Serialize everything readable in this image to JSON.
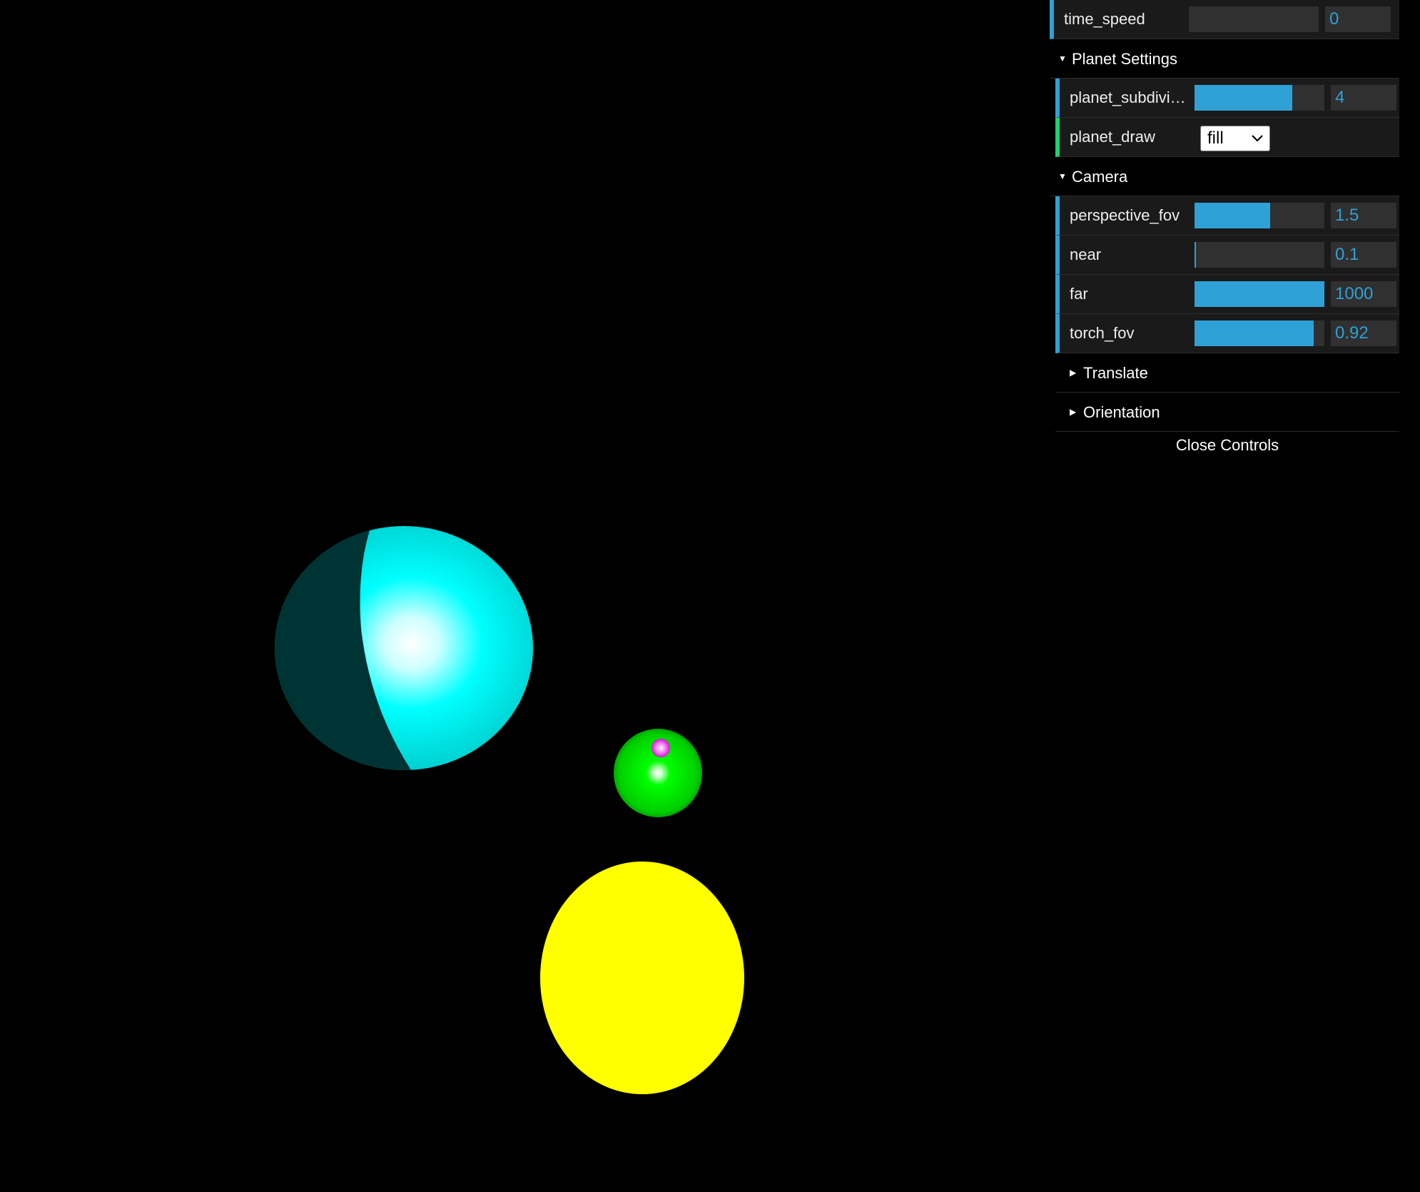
{
  "scene": {
    "background": "#000000",
    "bodies": [
      {
        "name": "cyan-planet",
        "color": "#00ffff"
      },
      {
        "name": "green-planet",
        "color": "#00e600"
      },
      {
        "name": "magenta-moon",
        "color": "#ff33ff"
      },
      {
        "name": "yellow-sun",
        "color": "#ffff00"
      }
    ]
  },
  "gui": {
    "accent_number": "#2fa1d6",
    "accent_option": "#1ed36f",
    "time_speed": {
      "label": "time_speed",
      "value": "0",
      "fill": 0.0
    },
    "planet_settings": {
      "title": "Planet Settings",
      "planet_subdivisions": {
        "label": "planet_subdivisions",
        "value": "4",
        "fill": 0.75
      },
      "planet_draw": {
        "label": "planet_draw",
        "value": "fill",
        "options": [
          "fill"
        ]
      }
    },
    "camera": {
      "title": "Camera",
      "perspective_fov": {
        "label": "perspective_fov",
        "value": "1.5",
        "fill": 0.58
      },
      "near": {
        "label": "near",
        "value": "0.1",
        "fill": 0.01
      },
      "far": {
        "label": "far",
        "value": "1000",
        "fill": 1.0
      },
      "torch_fov": {
        "label": "torch_fov",
        "value": "0.92",
        "fill": 0.92
      }
    },
    "translate": {
      "title": "Translate"
    },
    "orientation": {
      "title": "Orientation"
    },
    "close_label": "Close Controls"
  }
}
